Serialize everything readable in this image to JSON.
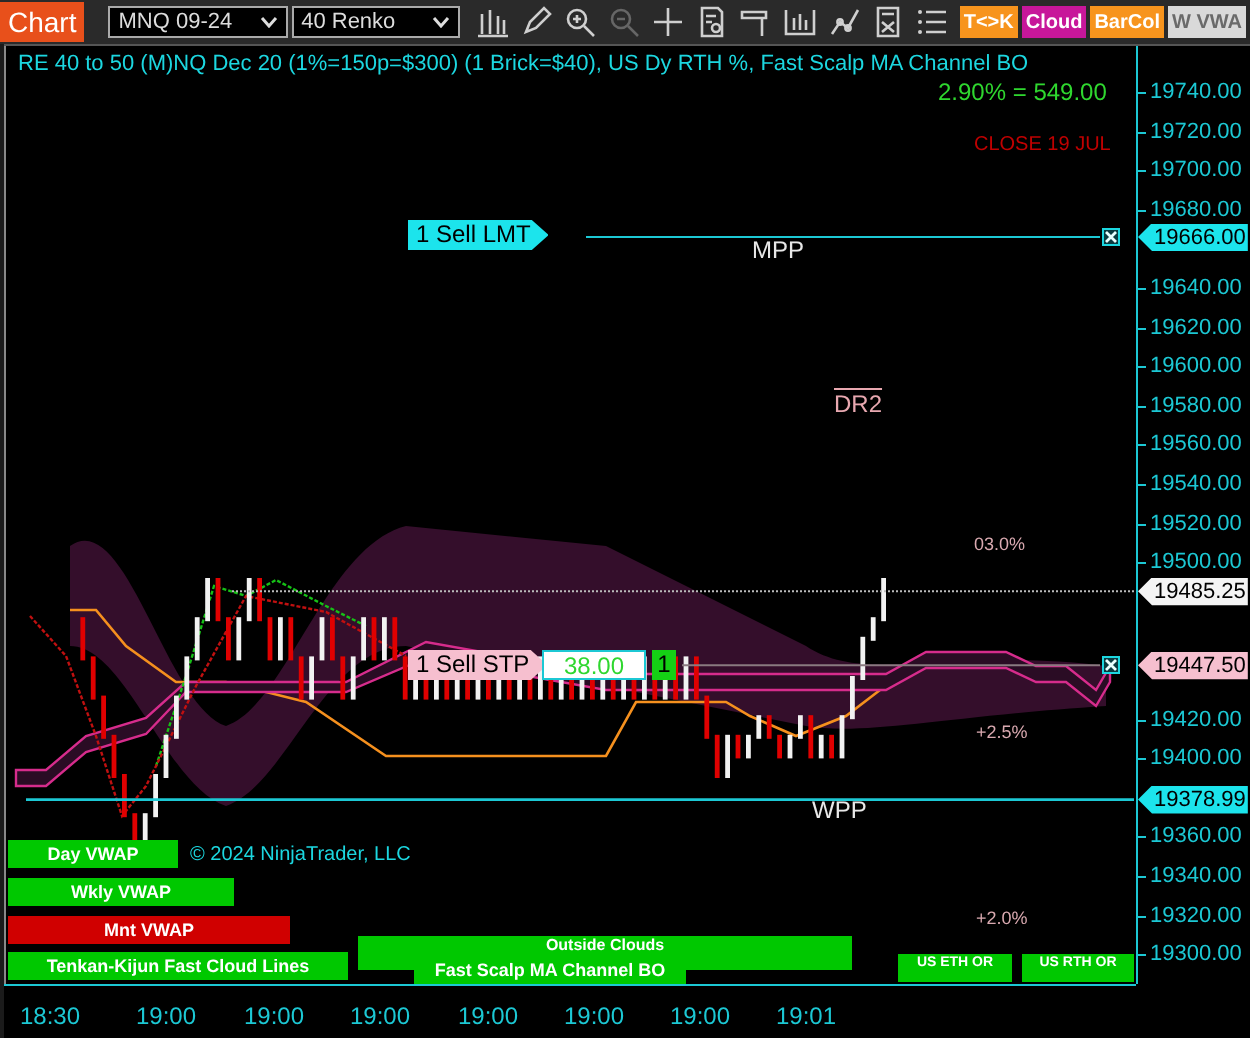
{
  "toolbar": {
    "title": "Chart",
    "instrument": "MNQ 09-24",
    "bar_type": "40 Renko",
    "buttons": [
      {
        "label": "T<>K",
        "color": "#f7941d"
      },
      {
        "label": "Cloud",
        "color": "#c7179a"
      },
      {
        "label": "BarCol",
        "color": "#f7941d"
      },
      {
        "label": "W VWA",
        "color": "#d9d9d9"
      }
    ]
  },
  "chart": {
    "title": "RE 40 to 50 (M)NQ Dec 20 (1%=150p=$300) (1 Brick=$40), US Dy RTH %, Fast Scalp MA Channel BO",
    "pnl": "2.90% = 549.00",
    "close_note": "CLOSE 19 JUL",
    "orders": [
      {
        "kind": "limit",
        "label": "1 Sell LMT"
      },
      {
        "kind": "stop",
        "label": "1 Sell STP",
        "value": "38.00",
        "quantity": "1"
      }
    ],
    "levels": [
      {
        "label": "MPP"
      },
      {
        "label": "DR2"
      },
      {
        "label": "03.0%"
      },
      {
        "label": "+2.5%"
      },
      {
        "label": "+2.0%"
      },
      {
        "label": "WPP"
      }
    ],
    "indicator_labels": [
      {
        "label": "Day VWAP",
        "color": "#00c800"
      },
      {
        "label": "Wkly VWAP",
        "color": "#00c800"
      },
      {
        "label": "Mnt VWAP",
        "color": "#d00000"
      },
      {
        "label": "Tenkan-Kijun Fast Cloud Lines",
        "color": "#00c800"
      },
      {
        "label": "Outside Clouds",
        "color": "#00c800"
      },
      {
        "label": "Fast Scalp MA Channel BO",
        "color": "#00c800"
      },
      {
        "label": "US ETH OR",
        "color": "#00c800"
      },
      {
        "label": "US RTH OR",
        "color": "#00c800"
      }
    ],
    "copyright": "© 2024 NinjaTrader, LLC",
    "price_axis": [
      "19740.00",
      "19720.00",
      "19700.00",
      "19680.00",
      "19640.00",
      "19620.00",
      "19600.00",
      "19580.00",
      "19560.00",
      "19540.00",
      "19520.00",
      "19500.00",
      "19420.00",
      "19400.00",
      "19360.00",
      "19340.00",
      "19320.00",
      "19300.00"
    ],
    "price_markers": [
      {
        "kind": "order",
        "label": "19666.00"
      },
      {
        "kind": "last",
        "label": "19485.25"
      },
      {
        "kind": "stop",
        "label": "19447.50"
      },
      {
        "kind": "level",
        "label": "19378.99"
      }
    ],
    "time_axis": [
      "18:30",
      "19:00",
      "19:00",
      "19:00",
      "19:00",
      "19:00",
      "19:00",
      "19:01"
    ]
  }
}
